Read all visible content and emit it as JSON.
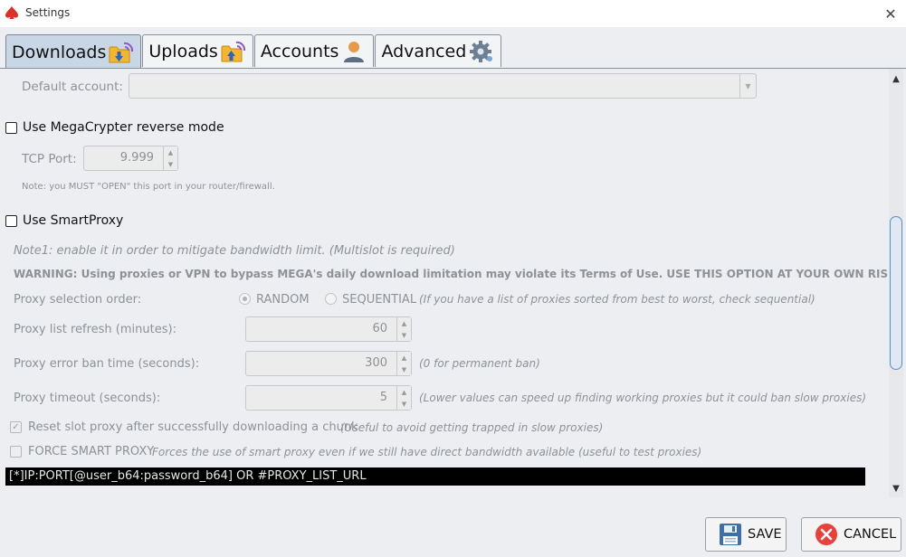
{
  "window": {
    "title": "Settings",
    "close_glyph": "✕"
  },
  "tabs": [
    {
      "label": "Downloads",
      "icon": "folder-download-icon",
      "active": true
    },
    {
      "label": "Uploads",
      "icon": "folder-upload-icon",
      "active": false
    },
    {
      "label": "Accounts",
      "icon": "user-icon",
      "active": false
    },
    {
      "label": "Advanced",
      "icon": "gear-icon",
      "active": false
    }
  ],
  "downloads": {
    "default_account_label": "Default account:",
    "default_account_value": "",
    "megacrypter_label": "Use MegaCrypter reverse mode",
    "tcp_port_label": "TCP Port:",
    "tcp_port_value": "9.999",
    "tcp_note": "Note: you MUST \"OPEN\" this port in your router/firewall.",
    "smartproxy_label": "Use SmartProxy",
    "note1": "Note1: enable it in order to mitigate bandwidth limit. (Multislot is required)",
    "warning": "WARNING: Using proxies or VPN to bypass MEGA's daily download limitation may violate its Terms of Use. USE THIS OPTION AT YOUR OWN RISK.",
    "selection_order_label": "Proxy selection order:",
    "radio_random": "RANDOM",
    "radio_sequential": "SEQUENTIAL",
    "selection_hint": "(If you have a list of proxies sorted from best to worst, check sequential)",
    "refresh_label": "Proxy list refresh (minutes):",
    "refresh_value": "60",
    "ban_label": "Proxy error ban time (seconds):",
    "ban_value": "300",
    "ban_hint": "(0 for permanent ban)",
    "timeout_label": "Proxy timeout (seconds):",
    "timeout_value": "5",
    "timeout_hint": "(Lower values can speed up finding working proxies but it could ban slow proxies)",
    "reset_slot_label": "Reset slot proxy after successfully downloading a chunk",
    "reset_slot_hint": "(Useful to avoid getting trapped in slow proxies)",
    "reset_slot_checked": true,
    "force_label": "FORCE SMART PROXY",
    "force_hint": "Forces the use of smart proxy even if we still have direct bandwidth available (useful to test proxies)",
    "proxy_list_text": "[*]IP:PORT[@user_b64:password_b64] OR #PROXY_LIST_URL"
  },
  "footer": {
    "save_label": "SAVE",
    "save_icon": "floppy-disk-icon",
    "cancel_label": "CANCEL",
    "cancel_icon": "cancel-x-icon"
  },
  "colors": {
    "tab_active": "#c8d6e6",
    "cancel_red": "#e8413c",
    "save_blue": "#3f6fa8",
    "scroll_accent": "#5b8fc7"
  }
}
